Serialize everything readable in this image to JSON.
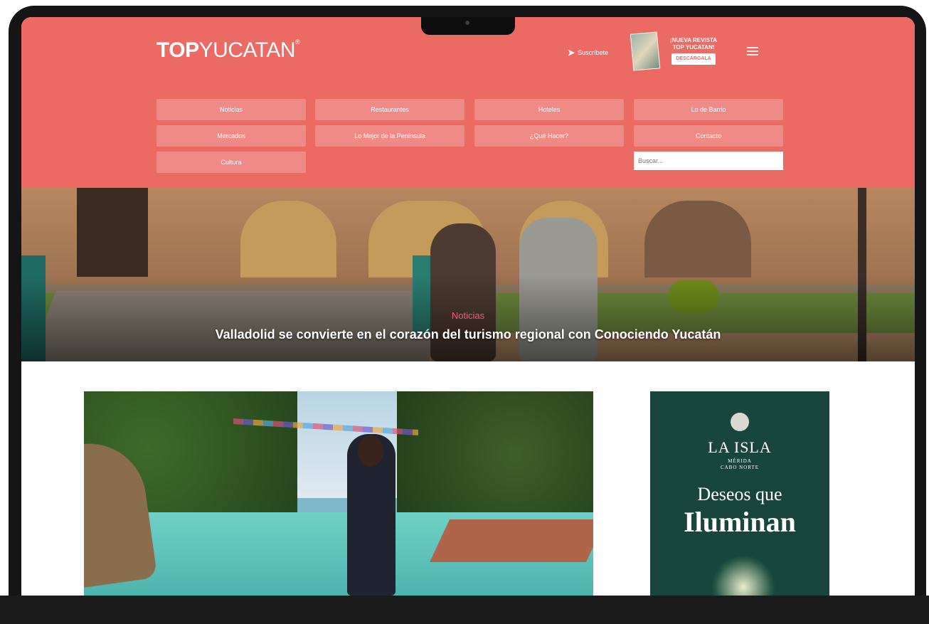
{
  "header": {
    "logo_bold": "TOP",
    "logo_light": "YUCATAN",
    "logo_mark": "®",
    "suscribe_label": "Suscríbete",
    "magazine_line1": "¡NUEVA REVISTA",
    "magazine_line2": "TOP YUCATAN!",
    "download_label": "DESCÁRGALA"
  },
  "menu": {
    "items": [
      "Noticias",
      "Restaurantes",
      "Hoteles",
      "Lo de Barrio",
      "Mercados",
      "Lo Mejor de la Península",
      "¿Qué Hacer?",
      "Contacto",
      "Cultura"
    ],
    "search_placeholder": "Buscar..."
  },
  "hero": {
    "category": "Noticias",
    "title": "Valladolid se convierte en el corazón del turismo regional con Conociendo Yucatán"
  },
  "ad": {
    "brand": "LA ISLA",
    "sub_line1": "MÉRIDA",
    "sub_line2": "CABO NORTE",
    "headline_1": "Deseos que",
    "headline_2": "Iluminan"
  }
}
